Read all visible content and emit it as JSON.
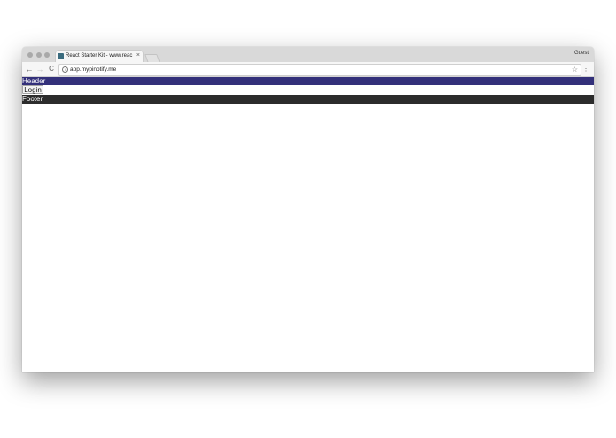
{
  "browser": {
    "tab": {
      "title": "React Starter Kit - www.reac",
      "close_glyph": "×",
      "favicon": "react-favicon"
    },
    "profile_label": "Guest",
    "toolbar": {
      "back_glyph": "←",
      "forward_glyph": "→",
      "reload_glyph": "C",
      "address": "app.mypinotify.me",
      "info_glyph": "i",
      "star_glyph": "☆",
      "menu_glyph": "⋮"
    }
  },
  "page": {
    "header_text": "Header",
    "login_label": "Login",
    "footer_text": "Footer"
  },
  "colors": {
    "header_bg": "#33307a",
    "footer_bg": "#2c2c2c"
  }
}
